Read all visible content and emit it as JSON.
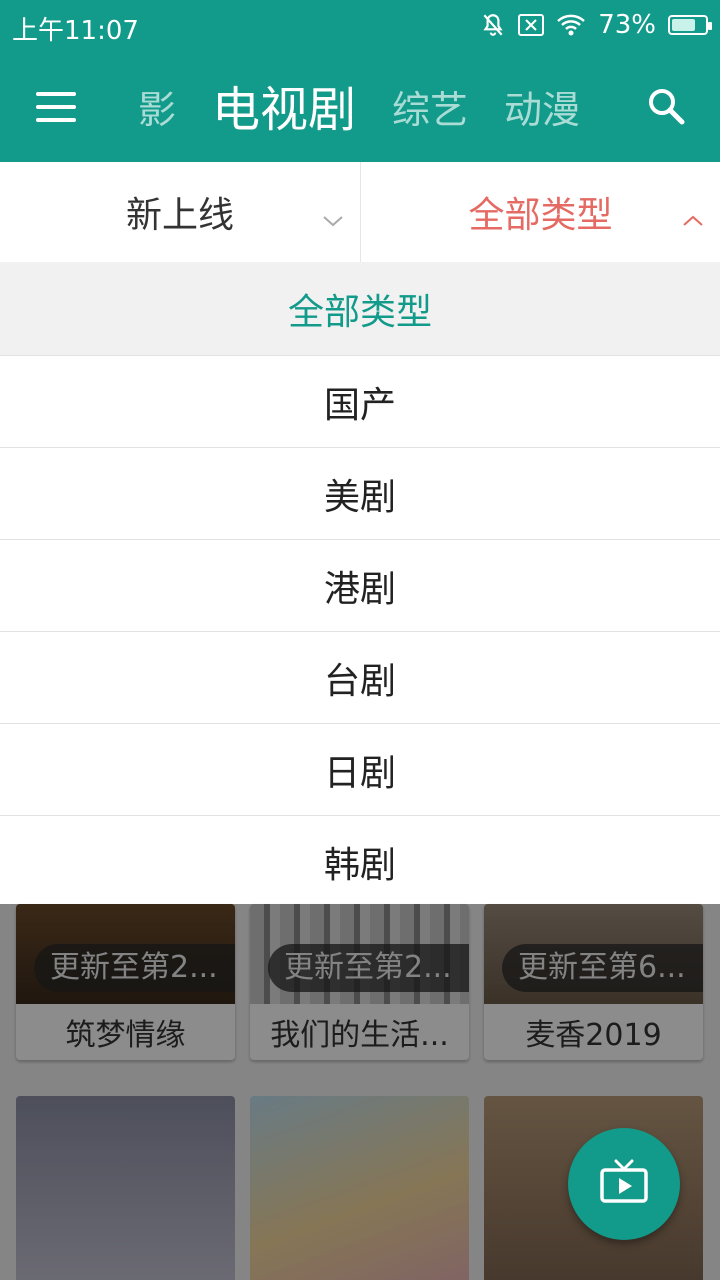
{
  "status_bar": {
    "time": "上午11:07",
    "battery": "73%",
    "battery_level": 0.73
  },
  "toolbar": {
    "tabs": [
      {
        "label": "影",
        "active": false
      },
      {
        "label": "电视剧",
        "active": true
      },
      {
        "label": "综艺",
        "active": false
      },
      {
        "label": "动漫",
        "active": false
      }
    ],
    "icons": {
      "menu": "menu-icon",
      "search": "search-icon"
    }
  },
  "filters": {
    "sort": {
      "label": "新上线",
      "icon": "chevron-down-icon"
    },
    "type": {
      "label": "全部类型",
      "icon": "chevron-up-icon"
    }
  },
  "dropdown": {
    "header": "全部类型",
    "items": [
      "国产",
      "美剧",
      "港剧",
      "台剧",
      "日剧",
      "韩剧"
    ]
  },
  "cards": [
    {
      "badge": "更新至第2...",
      "title": "筑梦情缘"
    },
    {
      "badge": "更新至第2...",
      "title": "我们的生活..."
    },
    {
      "badge": "更新至第6...",
      "title": "麦香2019"
    }
  ],
  "fab": {
    "icon": "tv-play-icon"
  },
  "colors": {
    "primary": "#129a8a",
    "active_filter": "#e46a63",
    "tab_inactive": "#a9dcd5"
  }
}
